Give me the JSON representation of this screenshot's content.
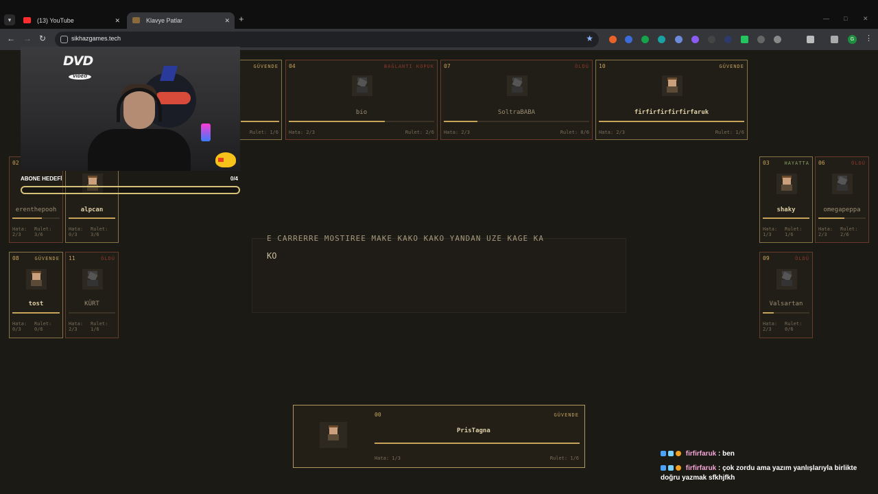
{
  "browser": {
    "tabs": [
      {
        "title": "(13) YouTube",
        "active": false
      },
      {
        "title": "Klavye Patlar",
        "active": true
      }
    ],
    "url": "sikhazgames.tech"
  },
  "game": {
    "players": [
      {
        "id": "p-partial",
        "num": "",
        "status": "GÜVENDE",
        "name": "",
        "hata": "",
        "rulet": "Rulet: 1/6",
        "bar": 1.0,
        "state": "safe"
      },
      {
        "id": "bio",
        "num": "04",
        "status": "BAĞLANTI KOPUK",
        "name": "bio",
        "hata": "Hata: 2/3",
        "rulet": "Rulet: 2/6",
        "bar": 0.66,
        "state": "lost"
      },
      {
        "id": "soltrababa",
        "num": "07",
        "status": "ÖLDÜ",
        "name": "SoltraBABA",
        "hata": "Hata: 2/3",
        "rulet": "Rulet: 0/6",
        "bar": 0.23,
        "state": "lost"
      },
      {
        "id": "firfirfaruk",
        "num": "10",
        "status": "GÜVENDE",
        "name": "firfirfirfirfirfaruk",
        "hata": "Hata: 2/3",
        "rulet": "Rulet: 1/6",
        "bar": 1.0,
        "state": "safe"
      },
      {
        "id": "erenthepooh",
        "num": "02",
        "status": "",
        "name": "erenthepooh",
        "hata": "Hata:\n2/3",
        "rulet": "Rulet:\n3/6",
        "bar": 0.63,
        "state": "lost"
      },
      {
        "id": "alpcan",
        "num": "",
        "status": "",
        "name": "alpcan",
        "hata": "Hata:\n0/3",
        "rulet": "Rulet:\n3/6",
        "bar": 1.0,
        "state": "safe"
      },
      {
        "id": "tost",
        "num": "08",
        "status": "GÜVENDE",
        "name": "tost",
        "hata": "Hata:\n0/3",
        "rulet": "Rulet:\n0/6",
        "bar": 1.0,
        "state": "safe"
      },
      {
        "id": "kurt",
        "num": "11",
        "status": "ÖLDÜ",
        "name": "KÜRT",
        "hata": "Hata:\n2/3",
        "rulet": "Rulet:\n1/6",
        "bar": 0.0,
        "state": "lost"
      },
      {
        "id": "shaky",
        "num": "03",
        "status": "HAYATTA",
        "name": "shaky",
        "hata": "Hata:\n1/3",
        "rulet": "Rulet:\n1/6",
        "bar": 1.0,
        "state": "alive"
      },
      {
        "id": "omegapeppa",
        "num": "06",
        "status": "ÖLDÜ",
        "name": "omegapeppa",
        "hata": "Hata:\n2/3",
        "rulet": "Rulet:\n2/6",
        "bar": 0.55,
        "state": "lost"
      },
      {
        "id": "valsartan",
        "num": "09",
        "status": "ÖLDÜ",
        "name": "Valsartan",
        "hata": "Hata:\n2/3",
        "rulet": "Rulet:\n0/6",
        "bar": 0.23,
        "state": "lost"
      }
    ],
    "self": {
      "num": "00",
      "status": "GÜVENDE",
      "name": "PrisTagna",
      "hata": "Hata: 1/3",
      "rulet": "Rulet: 1/6",
      "bar": 1.0
    },
    "typing": {
      "previous_line": "E CARRERRE MOSTIREE MAKE KAKO KAKO YANDAN ÜZE KAGE KA",
      "current": "KO"
    }
  },
  "stream": {
    "dvd_logo": "DVD",
    "dvd_sub": "VIDEO",
    "goal_label": "ABONE HEDEFİ",
    "goal_count": "0/4",
    "goal_progress": 0.0,
    "chat": [
      {
        "user": "firfirfaruk",
        "text": ": ben"
      },
      {
        "user": "firfirfaruk",
        "text": ": çok zordu ama yazım yanlışlarıyla birlikte doğru yazmak sfkhjfkh"
      }
    ]
  }
}
